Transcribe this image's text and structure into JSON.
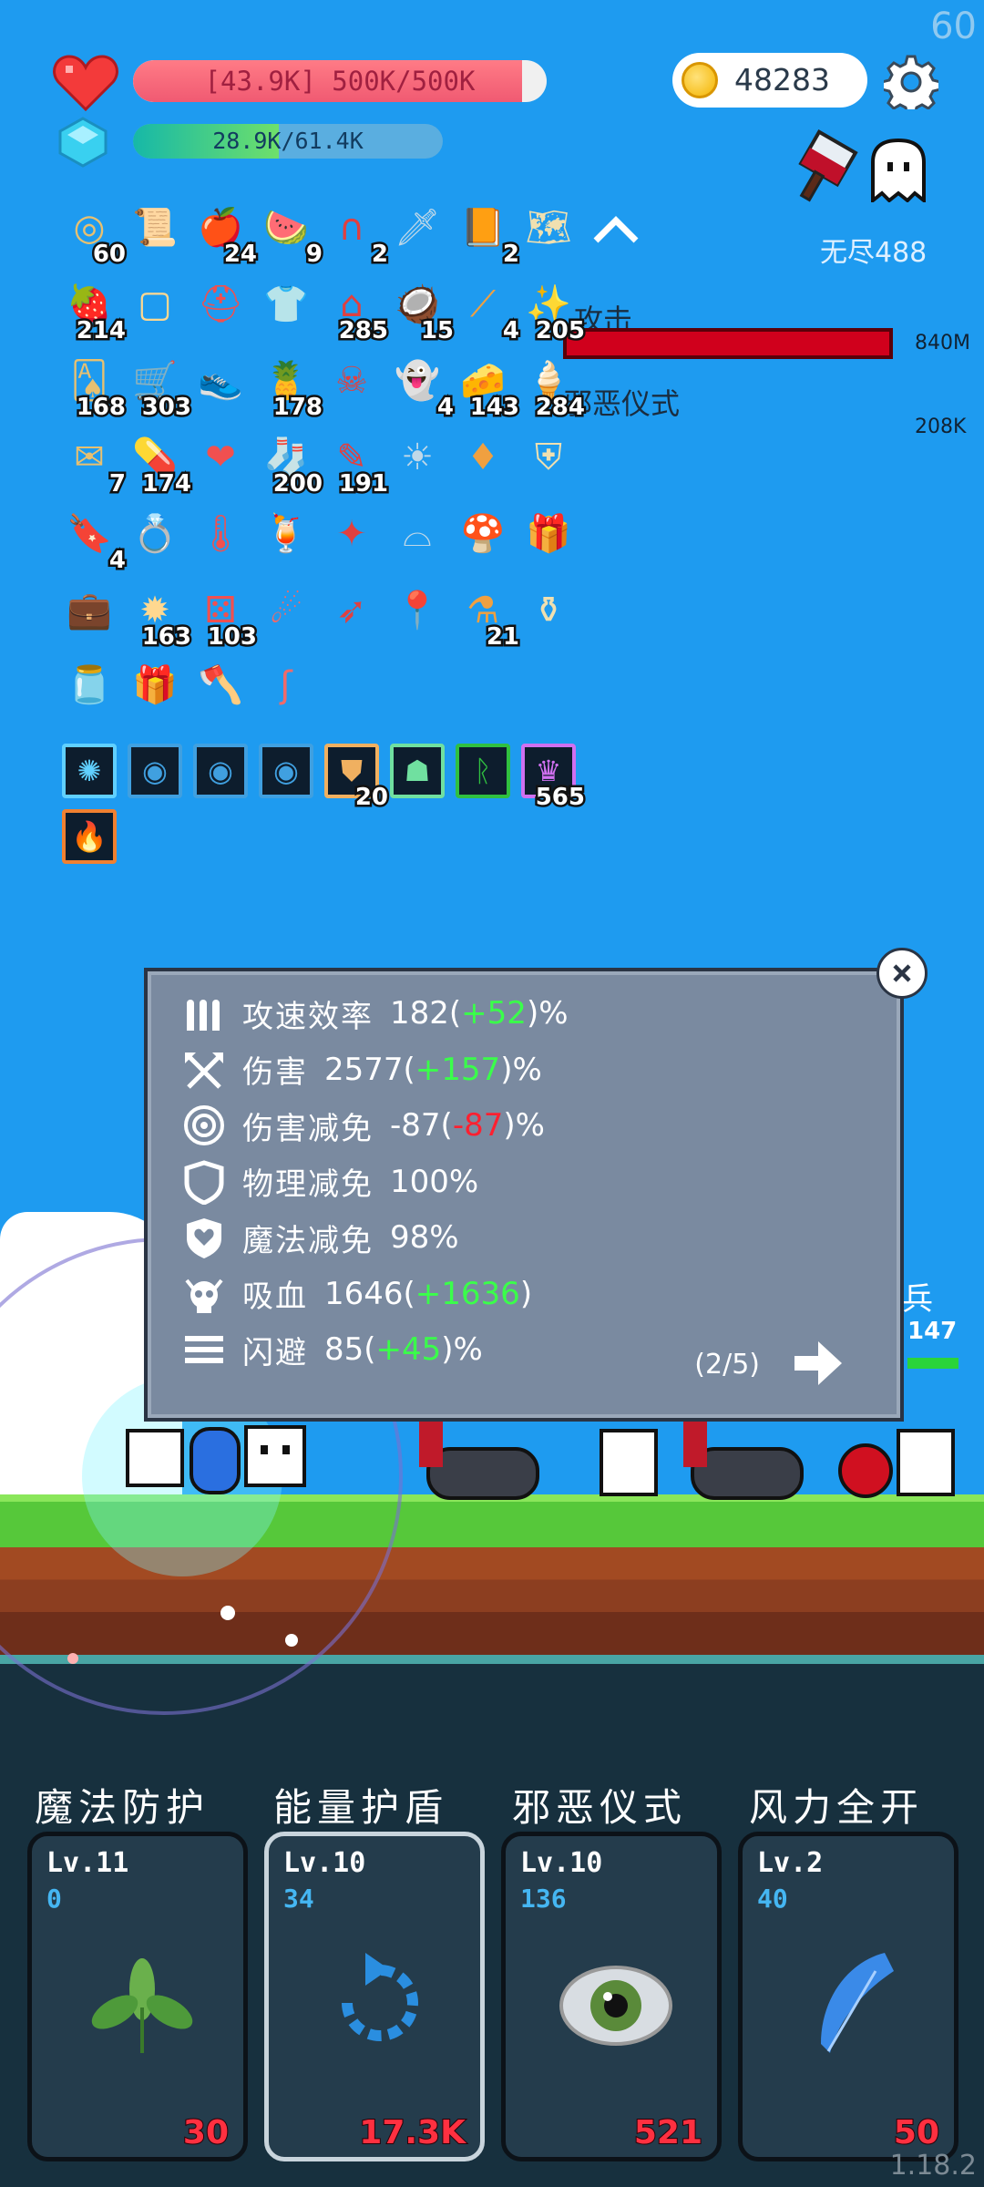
{
  "fps": "60",
  "player": {
    "hp_text": "[43.9K] 500K/500K",
    "hp_fraction": 0.94,
    "mp_text": "28.9K/61.4K",
    "mp_fraction": 0.47
  },
  "currency": {
    "coins": "48283"
  },
  "mode": {
    "endless_label": "无尽488"
  },
  "boss": {
    "line1_label": "攻击",
    "line1_value": "840M",
    "line2_label": "邪恶仪式",
    "line2_value": "208K"
  },
  "items": [
    {
      "icon": "target-shield-icon",
      "count": "60"
    },
    {
      "icon": "scroll-icon",
      "count": ""
    },
    {
      "icon": "apple-icon",
      "count": "24"
    },
    {
      "icon": "watermelon-icon",
      "count": "9"
    },
    {
      "icon": "magnet-icon",
      "count": "2"
    },
    {
      "icon": "sword-icon",
      "count": ""
    },
    {
      "icon": "book-icon",
      "count": "2"
    },
    {
      "icon": "treasure-map-icon",
      "count": ""
    },
    {
      "icon": "strawberry-icon",
      "count": "214"
    },
    {
      "icon": "frame-icon",
      "count": ""
    },
    {
      "icon": "helmet-icon",
      "count": ""
    },
    {
      "icon": "shirt-icon",
      "count": ""
    },
    {
      "icon": "tombstone-icon",
      "count": "285"
    },
    {
      "icon": "coconut-icon",
      "count": "15"
    },
    {
      "icon": "scalpel-icon",
      "count": "4"
    },
    {
      "icon": "sparkles-icon",
      "count": "205"
    },
    {
      "icon": "playing-cards-icon",
      "count": "168"
    },
    {
      "icon": "cart-icon",
      "count": "303"
    },
    {
      "icon": "sneaker-icon",
      "count": ""
    },
    {
      "icon": "pineapple-icon",
      "count": "178"
    },
    {
      "icon": "skull-book-icon",
      "count": ""
    },
    {
      "icon": "ghost-icon",
      "count": "4"
    },
    {
      "icon": "cheese-icon",
      "count": "143"
    },
    {
      "icon": "ice-cream-icon",
      "count": "284"
    },
    {
      "icon": "envelope-icon",
      "count": "7"
    },
    {
      "icon": "pill-icon",
      "count": "174"
    },
    {
      "icon": "heart-icon",
      "count": ""
    },
    {
      "icon": "sock-icon",
      "count": "200"
    },
    {
      "icon": "note-icon",
      "count": "191"
    },
    {
      "icon": "sun-icon",
      "count": ""
    },
    {
      "icon": "ruby-icon",
      "count": ""
    },
    {
      "icon": "shield-icon",
      "count": ""
    },
    {
      "icon": "bookmark-icon",
      "count": "4"
    },
    {
      "icon": "ring-icon",
      "count": ""
    },
    {
      "icon": "thermometer-icon",
      "count": ""
    },
    {
      "icon": "coconut-drink-icon",
      "count": ""
    },
    {
      "icon": "magic-wand-icon",
      "count": ""
    },
    {
      "icon": "mortar-icon",
      "count": ""
    },
    {
      "icon": "mushroom-icon",
      "count": ""
    },
    {
      "icon": "gift-box-icon",
      "count": ""
    },
    {
      "icon": "suitcase-icon",
      "count": ""
    },
    {
      "icon": "mace-icon",
      "count": "163"
    },
    {
      "icon": "dice-icon",
      "count": "103"
    },
    {
      "icon": "meteor-icon",
      "count": ""
    },
    {
      "icon": "bow-icon",
      "count": ""
    },
    {
      "icon": "location-pin-icon",
      "count": ""
    },
    {
      "icon": "potion-icon",
      "count": "21"
    },
    {
      "icon": "cauldron-icon",
      "count": ""
    },
    {
      "icon": "jam-jar-icon",
      "count": ""
    },
    {
      "icon": "present-icon",
      "count": ""
    },
    {
      "icon": "axe-icon",
      "count": ""
    },
    {
      "icon": "hook-icon",
      "count": ""
    }
  ],
  "buffs": [
    {
      "icon": "light-buff-icon",
      "count": ""
    },
    {
      "icon": "swirl-buff-icon",
      "count": ""
    },
    {
      "icon": "swirl-buff-icon",
      "count": ""
    },
    {
      "icon": "swirl-buff-icon",
      "count": ""
    },
    {
      "icon": "armor-buff-icon",
      "count": "20"
    },
    {
      "icon": "spirit-buff-icon",
      "count": ""
    },
    {
      "icon": "rune-buff-icon",
      "count": ""
    },
    {
      "icon": "crown-buff-icon",
      "count": "565"
    },
    {
      "icon": "fire-buff-icon",
      "count": ""
    }
  ],
  "stats": [
    {
      "icon": "bullets-icon",
      "label": "攻速效率",
      "value": "182",
      "open": "(",
      "delta": "+52",
      "close": ")",
      "unit": "%",
      "delta_sign": "pos"
    },
    {
      "icon": "crossed-axes-icon",
      "label": "伤害",
      "value": "2577",
      "open": "(",
      "delta": "+157",
      "close": ")",
      "unit": "%",
      "delta_sign": "pos"
    },
    {
      "icon": "target-icon",
      "label": "伤害减免",
      "value": "-87",
      "open": "(",
      "delta": "-87",
      "close": ")",
      "unit": "%",
      "delta_sign": "neg"
    },
    {
      "icon": "shield-icon",
      "label": "物理减免",
      "value": "100%",
      "open": "",
      "delta": "",
      "close": "",
      "unit": "",
      "delta_sign": ""
    },
    {
      "icon": "heart-shield-icon",
      "label": "魔法减免",
      "value": "98%",
      "open": "",
      "delta": "",
      "close": "",
      "unit": "",
      "delta_sign": ""
    },
    {
      "icon": "skull-icon",
      "label": "吸血",
      "value": "1646",
      "open": "(",
      "delta": "+1636",
      "close": ")",
      "unit": "",
      "delta_sign": "pos"
    },
    {
      "icon": "dodge-icon",
      "label": "闪避",
      "value": "85",
      "open": "(",
      "delta": "+45",
      "close": ")",
      "unit": "%",
      "delta_sign": "pos"
    }
  ],
  "pager": "(2/5)",
  "enemy": {
    "label": "兵",
    "number": "147"
  },
  "skills": [
    {
      "name": "魔法防护",
      "level": "Lv.11",
      "cost": "0",
      "count": "30",
      "icon": "leaf-icon"
    },
    {
      "name": "能量护盾",
      "level": "Lv.10",
      "cost": "34",
      "count": "17.3K",
      "icon": "refresh-icon"
    },
    {
      "name": "邪恶仪式",
      "level": "Lv.10",
      "cost": "136",
      "count": "521",
      "icon": "eye-icon"
    },
    {
      "name": "风力全开",
      "level": "Lv.2",
      "cost": "40",
      "count": "50",
      "icon": "feather-icon"
    }
  ],
  "version": "1.18.2",
  "colors": {
    "sky": "#1e9bf0",
    "hp": "#f05a72",
    "accent_green": "#3aff4a",
    "accent_red": "#ff2030"
  }
}
